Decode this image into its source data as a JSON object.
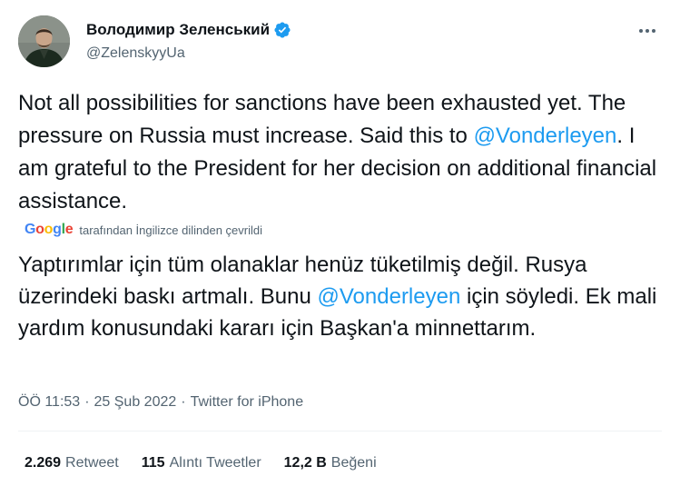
{
  "author": {
    "name": "Володимир Зеленський",
    "handle": "@ZelenskyyUa"
  },
  "tweet": {
    "text_en_parts": {
      "before": "Not all possibilities for sanctions have been exhausted yet. The pressure on Russia must increase. Said this to ",
      "mention": "@Vonderleyen",
      "after": ". I am grateful to the President for her decision on additional financial assistance."
    },
    "translation_note": "tarafından İngilizce dilinden çevrildi",
    "translation_brand": "Google",
    "text_tr_parts": {
      "before": "Yaptırımlar için tüm olanaklar henüz tüketilmiş değil. Rusya üzerindeki baskı artmalı. Bunu ",
      "mention": "@Vonderleyen",
      "after": " için söyledi. Ek mali yardım konusundaki kararı için Başkan'a minnettarım."
    },
    "time": "ÖÖ 11:53",
    "date": "25 Şub 2022",
    "separator": "·",
    "source": "Twitter for iPhone"
  },
  "stats": [
    {
      "count": "2.269",
      "label": "Retweet"
    },
    {
      "count": "115",
      "label": "Alıntı Tweetler"
    },
    {
      "count": "12,2 B",
      "label": "Beğeni"
    }
  ],
  "colors": {
    "accent": "#1d9bf0",
    "text": "#0f1419",
    "muted": "#536471",
    "divider": "#eff3f4"
  },
  "icons": {
    "verified": "verified-badge-icon",
    "more": "more-options-icon"
  }
}
